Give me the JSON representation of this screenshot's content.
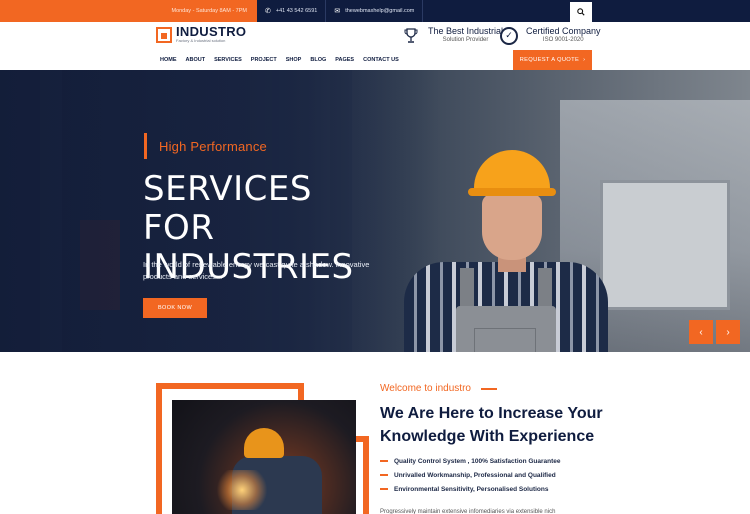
{
  "topbar": {
    "hours": "Monday - Saturday 8AM - 7PM",
    "phone": "+41 43 542 6591",
    "email": "thewebmaxhelp@gmail.com"
  },
  "brand": {
    "name": "INDUSTRO",
    "tagline": "Factory & Industrial solution",
    "accent": "#f26722",
    "navy": "#0f1c3f"
  },
  "badges": [
    {
      "title": "The Best Industrial",
      "subtitle": "Solution Provider",
      "icon": "trophy-icon"
    },
    {
      "title": "Certified Company",
      "subtitle": "ISO 9001-2020",
      "icon": "certificate-icon"
    }
  ],
  "nav": [
    "HOME",
    "ABOUT",
    "SERVICES",
    "PROJECT",
    "SHOP",
    "BLOG",
    "PAGES",
    "CONTACT US"
  ],
  "quote_button": "REQUEST A QUOTE",
  "hero": {
    "eyebrow": "High Performance",
    "title": "SERVICES FOR INDUSTRIES",
    "text": "In the world of renewable energy we cast quite a shadow. innovative products and services...",
    "button": "BOOK NOW"
  },
  "about": {
    "kicker": "Welcome to industro",
    "title": "We Are Here to Increase Your Knowledge With Experience",
    "points": [
      "Quality Control System , 100% Satisfaction Guarantee",
      "Unrivalled Workmanship, Professional and Qualified",
      "Environmental Sensitivity, Personalised Solutions"
    ],
    "text": "Progressively maintain extensive infomediaries via extensible nich"
  }
}
